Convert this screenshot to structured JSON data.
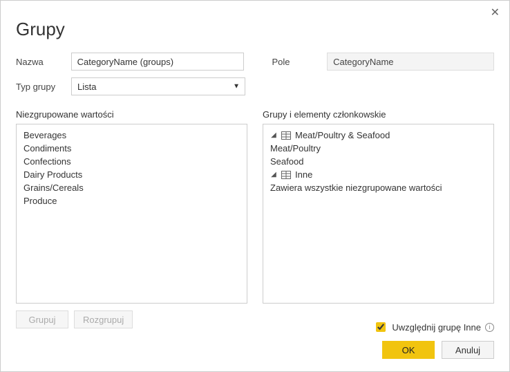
{
  "dialog": {
    "title": "Grupy",
    "close": "✕"
  },
  "form": {
    "nazwa_label": "Nazwa",
    "nazwa_value": "CategoryName (groups)",
    "pole_label": "Pole",
    "pole_value": "CategoryName",
    "typ_label": "Typ grupy",
    "typ_value": "Lista"
  },
  "left": {
    "header": "Niezgrupowane wartości",
    "items": [
      "Beverages",
      "Condiments",
      "Confections",
      "Dairy Products",
      "Grains/Cereals",
      "Produce"
    ]
  },
  "right": {
    "header": "Grupy i elementy członkowskie",
    "groups": [
      {
        "name": "Meat/Poultry & Seafood",
        "children": [
          "Meat/Poultry",
          "Seafood"
        ]
      },
      {
        "name": "Inne",
        "children": [
          "Zawiera wszystkie niezgrupowane wartości"
        ]
      }
    ]
  },
  "buttons": {
    "grupuj": "Grupuj",
    "rozgrupuj": "Rozgrupuj",
    "ok": "OK",
    "anuluj": "Anuluj"
  },
  "include_other": {
    "label": "Uwzględnij grupę Inne",
    "checked": true
  }
}
